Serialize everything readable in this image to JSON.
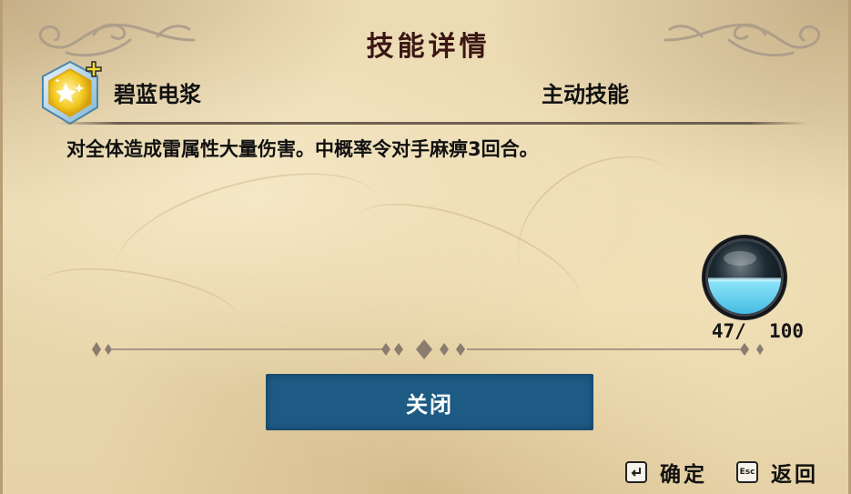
{
  "dialog": {
    "title": "技能详情"
  },
  "skill": {
    "name": "碧蓝电浆",
    "type": "主动技能",
    "description": "对全体造成雷属性大量伤害。中概率令对手麻痹3回合。",
    "icon": "lightning-star-hexagon-icon"
  },
  "resource": {
    "current": 47,
    "max": 100,
    "display": "47/  100",
    "fill_fraction": 0.47,
    "color": "#3fc3e6"
  },
  "buttons": {
    "close_label": "关闭"
  },
  "hints": {
    "confirm_label": "确定",
    "confirm_key_icon": "enter-key-icon",
    "back_label": "返回",
    "back_key_text": "Esc"
  },
  "colors": {
    "title": "#3b1613",
    "button": "#1d5a84",
    "parchment": "#ead9b0"
  }
}
